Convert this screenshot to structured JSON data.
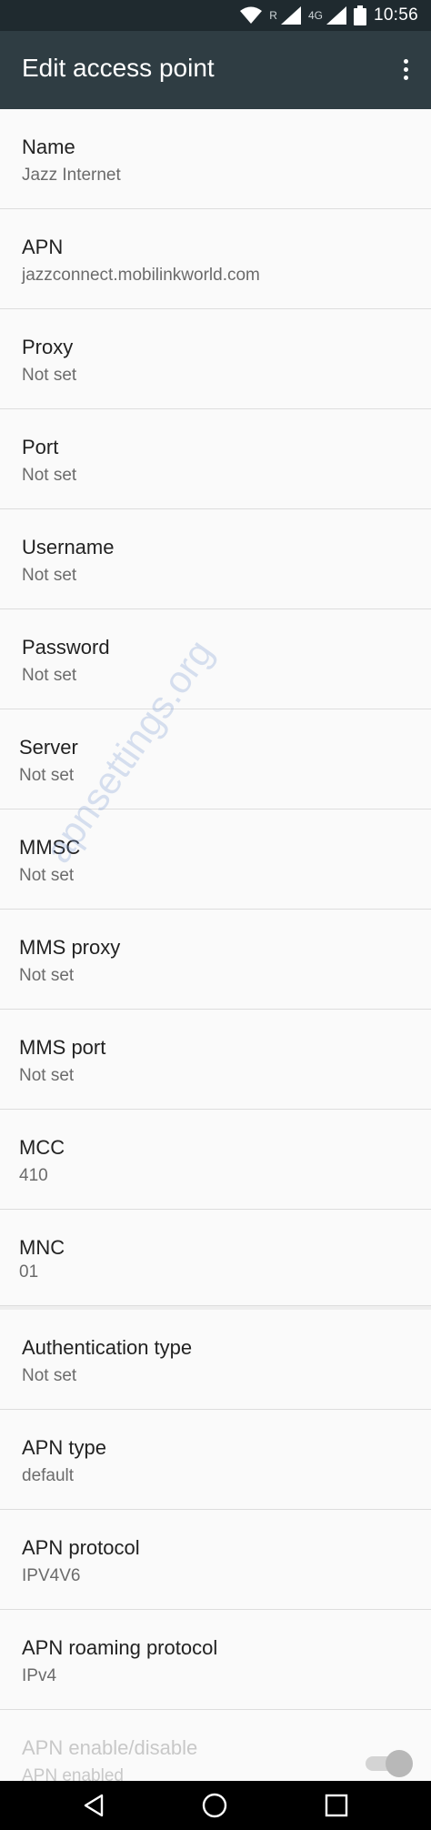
{
  "status_bar": {
    "network_label": "4G",
    "roaming_label": "R",
    "time": "10:56",
    "icons": [
      "wifi-icon",
      "signal-icon",
      "signal-icon",
      "battery-icon"
    ]
  },
  "app_bar": {
    "title": "Edit access point",
    "overflow_icon": "more-vert-icon"
  },
  "fields": [
    {
      "label": "Name",
      "value": "Jazz Internet"
    },
    {
      "label": "APN",
      "value": "jazzconnect.mobilinkworld.com"
    },
    {
      "label": "Proxy",
      "value": "Not set"
    },
    {
      "label": "Port",
      "value": "Not set"
    },
    {
      "label": "Username",
      "value": "Not set"
    },
    {
      "label": "Password",
      "value": "Not set"
    },
    {
      "label": "Server",
      "value": "Not set"
    },
    {
      "label": "MMSC",
      "value": "Not set"
    },
    {
      "label": "MMS proxy",
      "value": "Not set"
    },
    {
      "label": "MMS port",
      "value": "Not set"
    },
    {
      "label": "MCC",
      "value": "410"
    },
    {
      "label": "MNC",
      "value": "01"
    },
    {
      "label": "Authentication type",
      "value": "Not set"
    },
    {
      "label": "APN type",
      "value": "default"
    },
    {
      "label": "APN protocol",
      "value": "IPV4V6"
    },
    {
      "label": "APN roaming protocol",
      "value": "IPv4"
    },
    {
      "label": "APN enable/disable",
      "value": "APN enabled",
      "toggle_on": true,
      "disabled": true
    }
  ],
  "watermark": "apnsettings.org",
  "nav_bar": {
    "buttons": [
      "back-icon",
      "home-icon",
      "recents-icon"
    ]
  }
}
